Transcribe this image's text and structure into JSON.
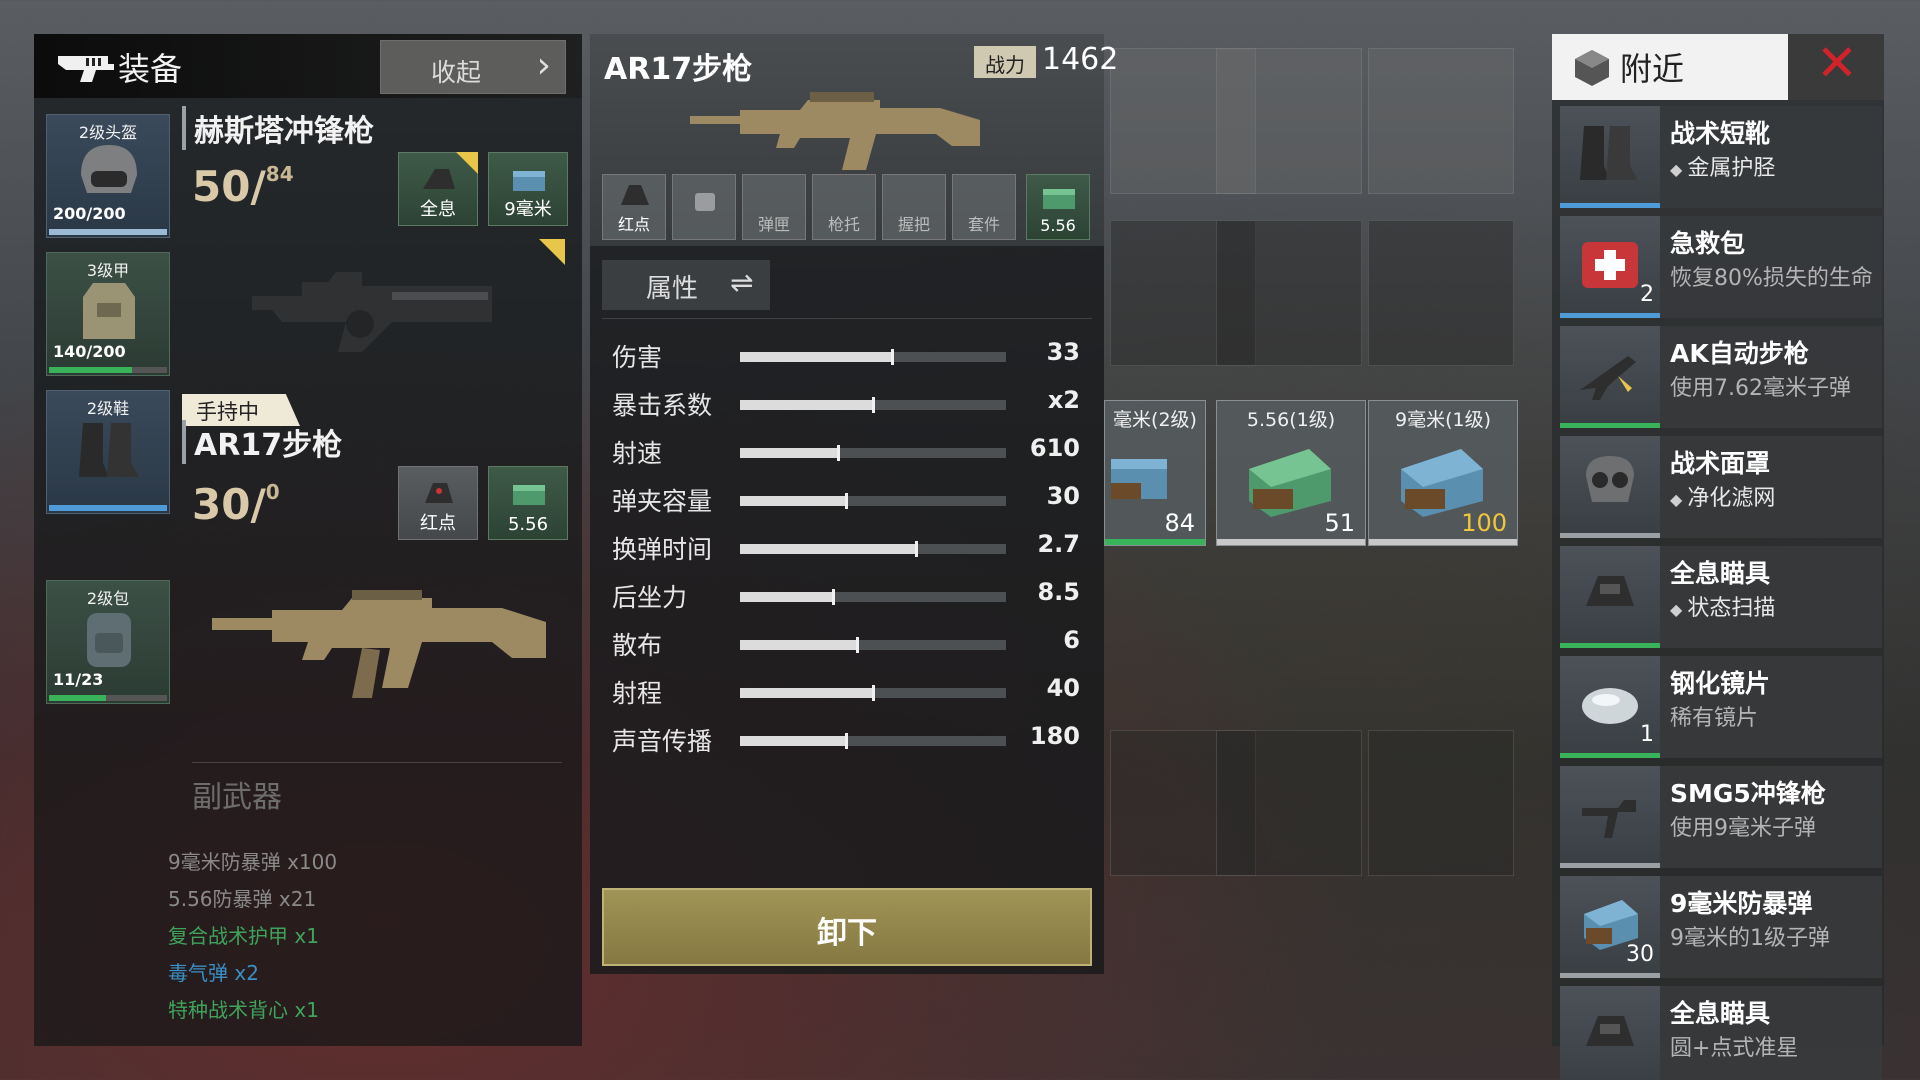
{
  "equipment": {
    "title": "装备",
    "collapse_label": "收起",
    "armor_slots": [
      {
        "name": "2级头盔",
        "durability": "200/200",
        "level": 1.0
      },
      {
        "name": "3级甲",
        "durability": "140/200",
        "level": 0.7
      },
      {
        "name": "2级鞋",
        "durability": "",
        "level": 0
      },
      {
        "name": "2级包",
        "durability": "11/23",
        "level": 0.48
      }
    ],
    "primary": {
      "name": "赫斯塔冲锋枪",
      "ammo": "50/",
      "reserve": "84",
      "attachments": [
        "全息",
        "9毫米"
      ]
    },
    "hold_tag": "手持中",
    "secondary": {
      "name": "AR17步枪",
      "ammo": "30/",
      "reserve": "0",
      "attachments": [
        "红点",
        "5.56"
      ]
    },
    "sidearm_label": "副武器",
    "backpack_lines": [
      {
        "text": "9毫米防暴弹 x100",
        "color": "#8a8a8a"
      },
      {
        "text": "5.56防暴弹 x21",
        "color": "#8a8a8a"
      },
      {
        "text": "复合战术护甲 x1",
        "color": "#3fa35a"
      },
      {
        "text": "毒气弹 x2",
        "color": "#3a8fc4"
      },
      {
        "text": "特种战术背心 x1",
        "color": "#3fa35a"
      }
    ]
  },
  "detail": {
    "title": "AR17步枪",
    "power_label": "战力",
    "power_value": "1462",
    "slots": [
      "红点",
      "",
      "弹匣",
      "枪托",
      "握把",
      "套件",
      "5.56"
    ],
    "attr_label": "属性",
    "stats": [
      {
        "name": "伤害",
        "value": "33",
        "level": 0.57
      },
      {
        "name": "暴击系数",
        "value": "x2",
        "level": 0.5
      },
      {
        "name": "射速",
        "value": "610",
        "level": 0.37
      },
      {
        "name": "弹夹容量",
        "value": "30",
        "level": 0.4
      },
      {
        "name": "换弹时间",
        "value": "2.7",
        "level": 0.66
      },
      {
        "name": "后坐力",
        "value": "8.5",
        "level": 0.35
      },
      {
        "name": "散布",
        "value": "6",
        "level": 0.44
      },
      {
        "name": "射程",
        "value": "40",
        "level": 0.5
      },
      {
        "name": "声音传播",
        "value": "180",
        "level": 0.4
      }
    ],
    "unload_label": "卸下"
  },
  "ground": {
    "ammo_boxes": [
      {
        "label": "毫米(2级)",
        "qty": "84",
        "qty_color": "#ffffff",
        "bar": "#39b35a"
      },
      {
        "label": "5.56(1级)",
        "qty": "51",
        "qty_color": "#ffffff",
        "bar": "#c8c8c8"
      },
      {
        "label": "9毫米(1级)",
        "qty": "100",
        "qty_color": "#f0c63a",
        "bar": "#c8c8c8"
      }
    ]
  },
  "nearby": {
    "title": "附近",
    "items": [
      {
        "name": "战术短靴",
        "desc": "金属护胫",
        "perk": true,
        "count": "",
        "rarity": "blue",
        "icon": "boots-icon"
      },
      {
        "name": "急救包",
        "desc": "恢复80%损失的生命",
        "perk": false,
        "count": "2",
        "rarity": "blue",
        "icon": "medkit-icon"
      },
      {
        "name": "AK自动步枪",
        "desc": "使用7.62毫米子弹",
        "perk": false,
        "count": "",
        "rarity": "green",
        "icon": "rifle-icon"
      },
      {
        "name": "战术面罩",
        "desc": "净化滤网",
        "perk": true,
        "count": "",
        "rarity": "gray",
        "icon": "mask-icon"
      },
      {
        "name": "全息瞄具",
        "desc": "状态扫描",
        "perk": true,
        "count": "",
        "rarity": "green",
        "icon": "scope-icon"
      },
      {
        "name": "钢化镜片",
        "desc": "稀有镜片",
        "perk": false,
        "count": "1",
        "rarity": "green",
        "icon": "lens-icon"
      },
      {
        "name": "SMG5冲锋枪",
        "desc": "使用9毫米子弹",
        "perk": false,
        "count": "",
        "rarity": "gray",
        "icon": "smg-icon"
      },
      {
        "name": "9毫米防暴弹",
        "desc": "9毫米的1级子弹",
        "perk": false,
        "count": "30",
        "rarity": "gray",
        "icon": "ammo-box-icon"
      },
      {
        "name": "全息瞄具",
        "desc": "圆+点式准星",
        "perk": false,
        "count": "",
        "rarity": "gray",
        "icon": "scope-icon"
      }
    ]
  }
}
